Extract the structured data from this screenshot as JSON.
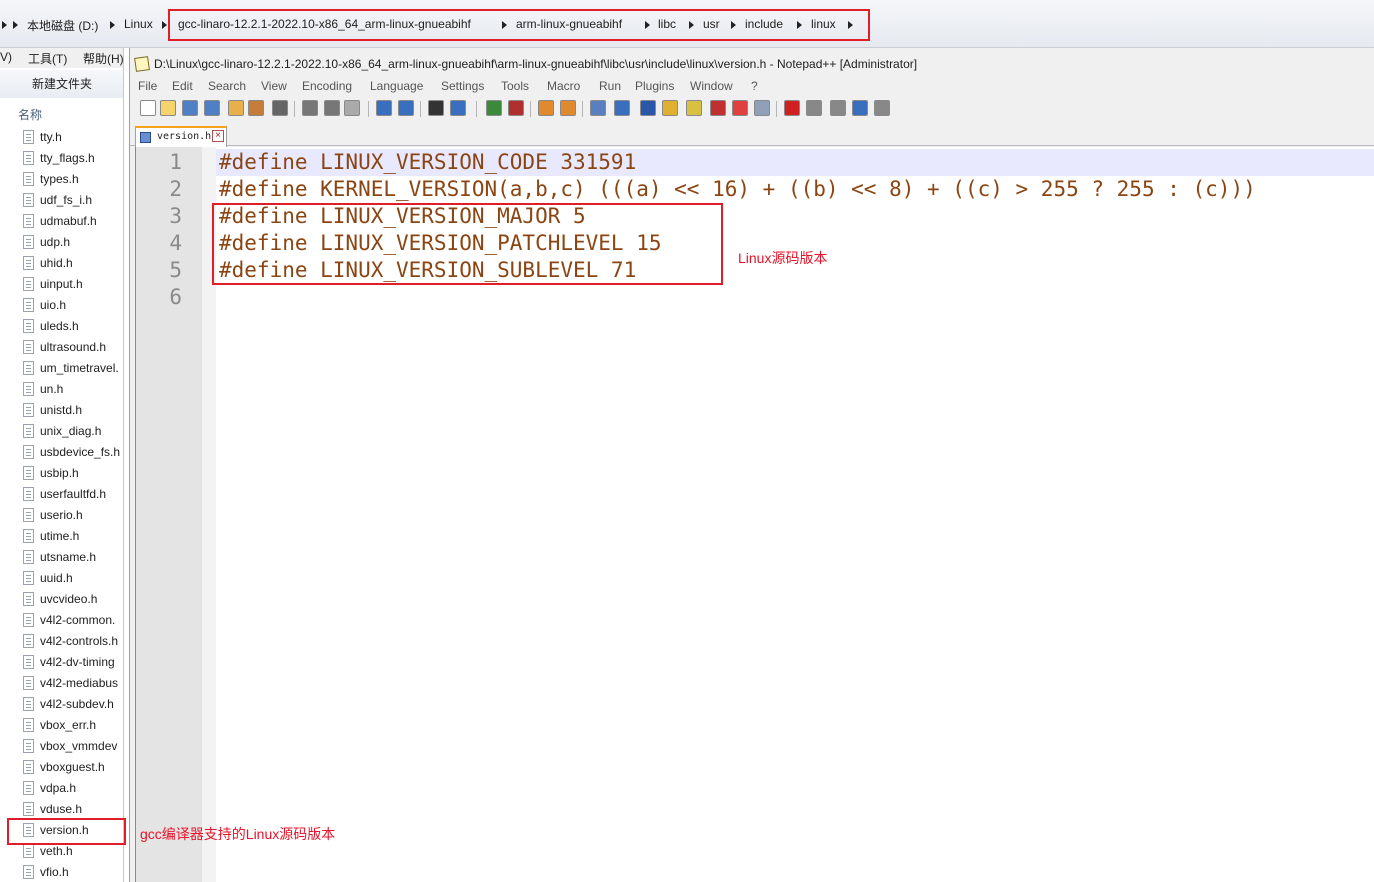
{
  "explorer": {
    "breadcrumbs": [
      "本地磁盘 (D:)",
      "Linux",
      "gcc-linaro-12.2.1-2022.10-x86_64_arm-linux-gnueabihf",
      "arm-linux-gnueabihf",
      "libc",
      "usr",
      "include",
      "linux"
    ],
    "menu": [
      "V)",
      "工具(T)",
      "帮助(H)"
    ],
    "new_folder": "新建文件夹",
    "column_name": "名称",
    "files": [
      "tty.h",
      "tty_flags.h",
      "types.h",
      "udf_fs_i.h",
      "udmabuf.h",
      "udp.h",
      "uhid.h",
      "uinput.h",
      "uio.h",
      "uleds.h",
      "ultrasound.h",
      "um_timetravel.",
      "un.h",
      "unistd.h",
      "unix_diag.h",
      "usbdevice_fs.h",
      "usbip.h",
      "userfaultfd.h",
      "userio.h",
      "utime.h",
      "utsname.h",
      "uuid.h",
      "uvcvideo.h",
      "v4l2-common.",
      "v4l2-controls.h",
      "v4l2-dv-timing",
      "v4l2-mediabus",
      "v4l2-subdev.h",
      "vbox_err.h",
      "vbox_vmmdev",
      "vboxguest.h",
      "vdpa.h",
      "vduse.h",
      "version.h",
      "veth.h",
      "vfio.h"
    ]
  },
  "notepad": {
    "title": "D:\\Linux\\gcc-linaro-12.2.1-2022.10-x86_64_arm-linux-gnueabihf\\arm-linux-gnueabihf\\libc\\usr\\include\\linux\\version.h - Notepad++ [Administrator]",
    "menu": [
      "File",
      "Edit",
      "Search",
      "View",
      "Encoding",
      "Language",
      "Settings",
      "Tools",
      "Macro",
      "Run",
      "Plugins",
      "Window",
      "?"
    ],
    "tab": "version.h",
    "lines": [
      "#define LINUX_VERSION_CODE 331591",
      "#define KERNEL_VERSION(a,b,c) (((a) << 16) + ((b) << 8) + ((c) > 255 ? 255 : (c)))",
      "#define LINUX_VERSION_MAJOR 5",
      "#define LINUX_VERSION_PATCHLEVEL 15",
      "#define LINUX_VERSION_SUBLEVEL 71",
      ""
    ],
    "line_numbers": [
      "1",
      "2",
      "3",
      "4",
      "5",
      "6"
    ]
  },
  "annotations": {
    "source_version": "Linux源码版本",
    "gcc_support": "gcc编译器支持的Linux源码版本"
  },
  "colors": {
    "annotation_red": "#e01e2a",
    "keyword_brown": "#8b4513",
    "current_line": "#e8e8ff"
  }
}
